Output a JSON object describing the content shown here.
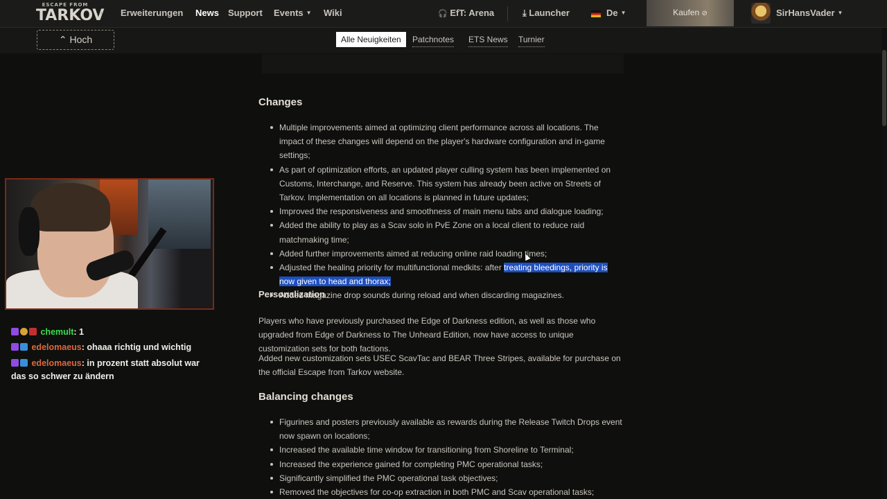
{
  "header": {
    "logo_small": "ESCAPE FROM",
    "logo_big": "TARKOV",
    "nav": [
      "Erweiterungen",
      "News",
      "Support",
      "Events",
      "Wiki"
    ],
    "arena": "EfT: Arena",
    "launcher": "Launcher",
    "language": "De",
    "buy": "Kaufen",
    "username": "SirHansVader"
  },
  "subnav": {
    "up_button": "Hoch",
    "tabs": [
      "Alle Neuigkeiten",
      "Patchnotes",
      "ETS News",
      "Turnier"
    ],
    "active_tab": "Alle Neuigkeiten"
  },
  "article": {
    "changes_heading": "Changes",
    "changes": [
      "Multiple improvements aimed at optimizing client performance across all locations. The impact of these changes will depend on the player's hardware configuration and in-game settings;",
      "As part of optimization efforts, an updated player culling system has been implemented on Customs, Interchange, and Reserve. This system has already been active on Streets of Tarkov. Implementation on all locations is planned in future updates;",
      "Improved the responsiveness and smoothness of main menu tabs and dialogue loading;",
      "Added the ability to play as a Scav solo in PvE Zone on a local client to reduce raid matchmaking time;",
      "Added further improvements aimed at reducing online raid loading times;",
      "Adjusted the healing priority for multifunctional medkits: after ",
      "Added magazine drop sounds during reload and when discarding magazines."
    ],
    "highlighted_text": "treating bleedings, priority is now given to head and thorax;",
    "personalization_heading": "Personalization",
    "personalization_p1": "Players who have previously purchased the Edge of Darkness edition, as well as those who upgraded from Edge of Darkness to The Unheard Edition, now have access to unique customization sets for both factions.",
    "personalization_p2": "Added new customization sets USEC ScavTac and BEAR Three Stripes, available for purchase on the official Escape from Tarkov website.",
    "balancing_heading": "Balancing changes",
    "balancing": [
      "Figurines and posters previously available as rewards during the Release Twitch Drops event now spawn on locations;",
      "Increased the available time window for transitioning from Shoreline to Terminal;",
      "Increased the experience gained for completing PMC operational tasks;",
      "Significantly simplified the PMC operational task objectives;",
      "Removed the objectives for co-op extraction in both PMC and Scav operational tasks;"
    ]
  },
  "chat": [
    {
      "user": "chemult",
      "text": ": 1"
    },
    {
      "user": "edelomaeus",
      "text": ": ohaaa richtig und wichtig"
    },
    {
      "user": "edelomaeus",
      "text": ": in prozent statt absolut war das so schwer zu ändern"
    }
  ],
  "colors": {
    "highlight": "#1d4fc0",
    "chat_green": "#3fdc4d",
    "chat_orange": "#e0673a",
    "background": "#0f0f0e"
  }
}
